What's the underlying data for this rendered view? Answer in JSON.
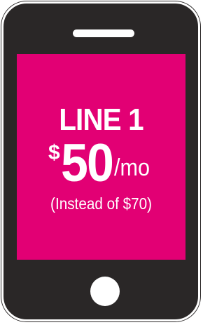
{
  "colors": {
    "phone_body": "#2a2727",
    "screen": "#e20074",
    "text": "#ffffff"
  },
  "offer": {
    "line_label": "LINE 1",
    "currency": "$",
    "amount": "50",
    "period": "/mo",
    "original_note": "(Instead of $70)"
  },
  "icons": {
    "speaker": "speaker-slot-icon",
    "home_button": "home-button-icon"
  }
}
